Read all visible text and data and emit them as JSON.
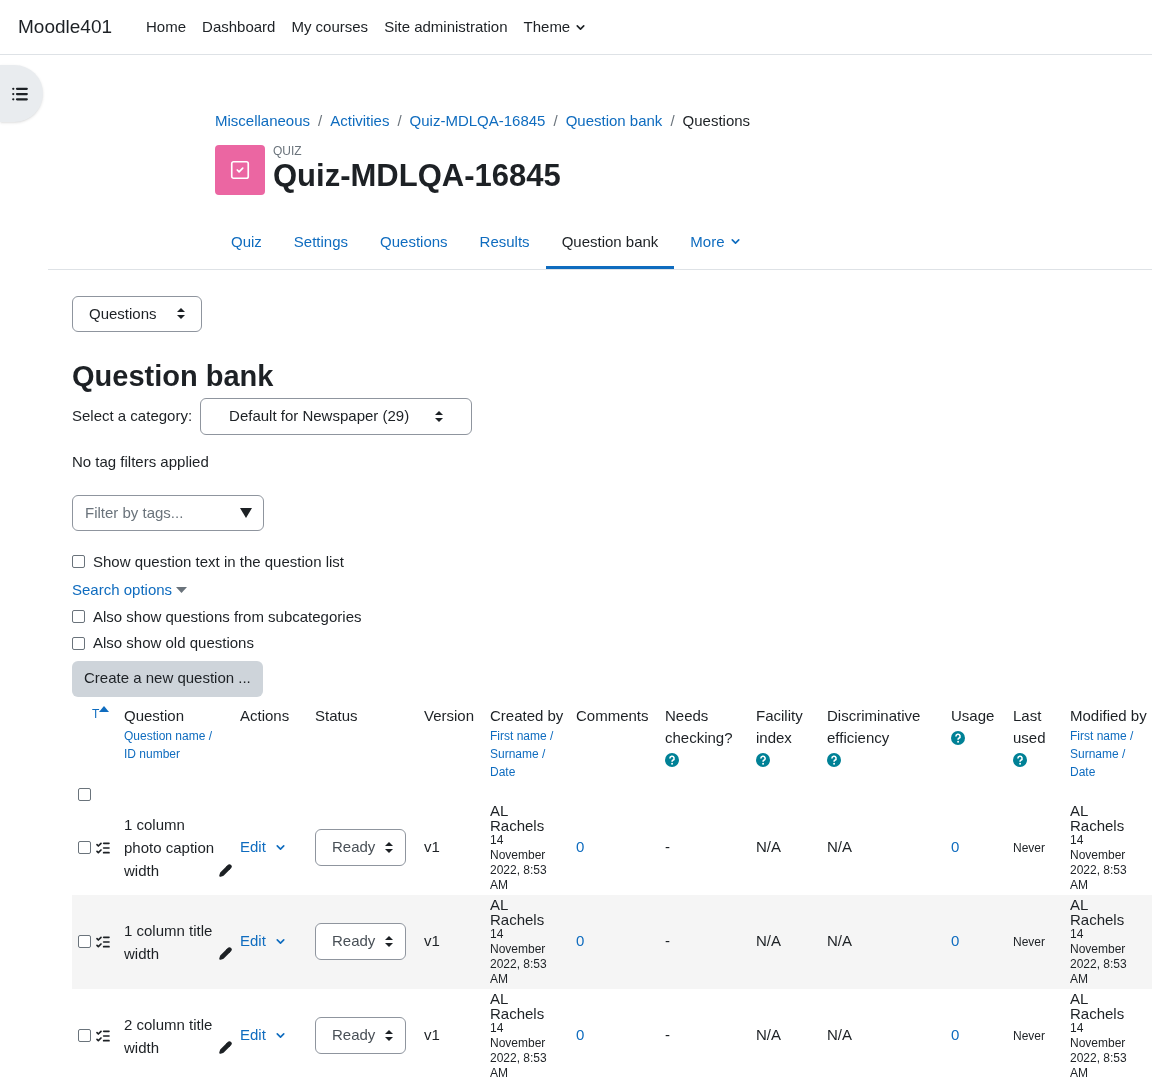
{
  "navbar": {
    "brand": "Moodle401",
    "items": [
      {
        "label": "Home",
        "has_menu": false
      },
      {
        "label": "Dashboard",
        "has_menu": false
      },
      {
        "label": "My courses",
        "has_menu": false
      },
      {
        "label": "Site administration",
        "has_menu": false
      },
      {
        "label": "Theme",
        "has_menu": true
      }
    ]
  },
  "breadcrumb": [
    {
      "label": "Miscellaneous",
      "current": false
    },
    {
      "separator": "/",
      "label": "Activities",
      "current": false
    },
    {
      "separator": "/",
      "label": "Quiz-MDLQA-16845",
      "current": false
    },
    {
      "separator": "/",
      "label": "Question bank",
      "current": false
    },
    {
      "separator": "/",
      "label": "Questions",
      "current": true
    }
  ],
  "activity": {
    "type_label": "QUIZ",
    "title": "Quiz-MDLQA-16845"
  },
  "tabs": [
    {
      "label": "Quiz",
      "selected": false,
      "has_menu": false
    },
    {
      "label": "Settings",
      "selected": false,
      "has_menu": false
    },
    {
      "label": "Questions",
      "selected": false,
      "has_menu": false
    },
    {
      "label": "Results",
      "selected": false,
      "has_menu": false
    },
    {
      "label": "Question bank",
      "selected": true,
      "has_menu": false
    },
    {
      "label": "More",
      "selected": false,
      "has_menu": true
    }
  ],
  "page_select": "Questions",
  "heading": "Question bank",
  "category": {
    "label": "Select a category:",
    "value": "Default for Newspaper (29)"
  },
  "tag_status": "No tag filters applied",
  "tag_filter": {
    "placeholder": "Filter by tags..."
  },
  "show_text": {
    "label": "Show question text in the question list",
    "checked": false
  },
  "search_options": "Search options",
  "options": [
    {
      "label": "Also show questions from subcategories",
      "checked": false
    },
    {
      "label": "Also show old questions",
      "checked": false
    }
  ],
  "create_button": "Create a new question ...",
  "table": {
    "type_sort": "T",
    "select_all_checked": false,
    "columns": [
      {
        "label": "Question",
        "sort_links": [
          "Question name /",
          "ID number"
        ],
        "help": false
      },
      {
        "label": "Actions",
        "help": false
      },
      {
        "label": "Status",
        "help": false
      },
      {
        "label": "Version",
        "help": false
      },
      {
        "label": "Created by",
        "sort_links": [
          "First name /",
          "Surname /",
          "Date"
        ],
        "help": false
      },
      {
        "label": "Comments",
        "help": false
      },
      {
        "label": "Needs checking?",
        "help": true
      },
      {
        "label": "Facility index",
        "help": true
      },
      {
        "label": "Discriminative efficiency",
        "help": true
      },
      {
        "label": "Usage",
        "help": true
      },
      {
        "label": "Last used",
        "help": true
      },
      {
        "label": "Modified by",
        "sort_links": [
          "First name /",
          "Surname /",
          "Date"
        ],
        "help": false
      }
    ],
    "rows": [
      {
        "checked": false,
        "name": "1 column photo caption width",
        "action": "Edit",
        "status": "Ready",
        "version": "v1",
        "created_name": "AL Rachels",
        "created_date": "14 November 2022, 8:53 AM",
        "comments": "0",
        "needs_checking": "-",
        "facility": "N/A",
        "discriminative": "N/A",
        "usage": "0",
        "last_used": "Never",
        "modified_name": "AL Rachels",
        "modified_date": "14 November 2022, 8:53 AM"
      },
      {
        "checked": false,
        "name": "1 column title width",
        "action": "Edit",
        "status": "Ready",
        "version": "v1",
        "created_name": "AL Rachels",
        "created_date": "14 November 2022, 8:53 AM",
        "comments": "0",
        "needs_checking": "-",
        "facility": "N/A",
        "discriminative": "N/A",
        "usage": "0",
        "last_used": "Never",
        "modified_name": "AL Rachels",
        "modified_date": "14 November 2022, 8:53 AM"
      },
      {
        "checked": false,
        "name": "2 column title width",
        "action": "Edit",
        "status": "Ready",
        "version": "v1",
        "created_name": "AL Rachels",
        "created_date": "14 November 2022, 8:53 AM",
        "comments": "0",
        "needs_checking": "-",
        "facility": "N/A",
        "discriminative": "N/A",
        "usage": "0",
        "last_used": "Never",
        "modified_name": "AL Rachels",
        "modified_date": "14 November 2022, 8:53 AM"
      }
    ]
  }
}
